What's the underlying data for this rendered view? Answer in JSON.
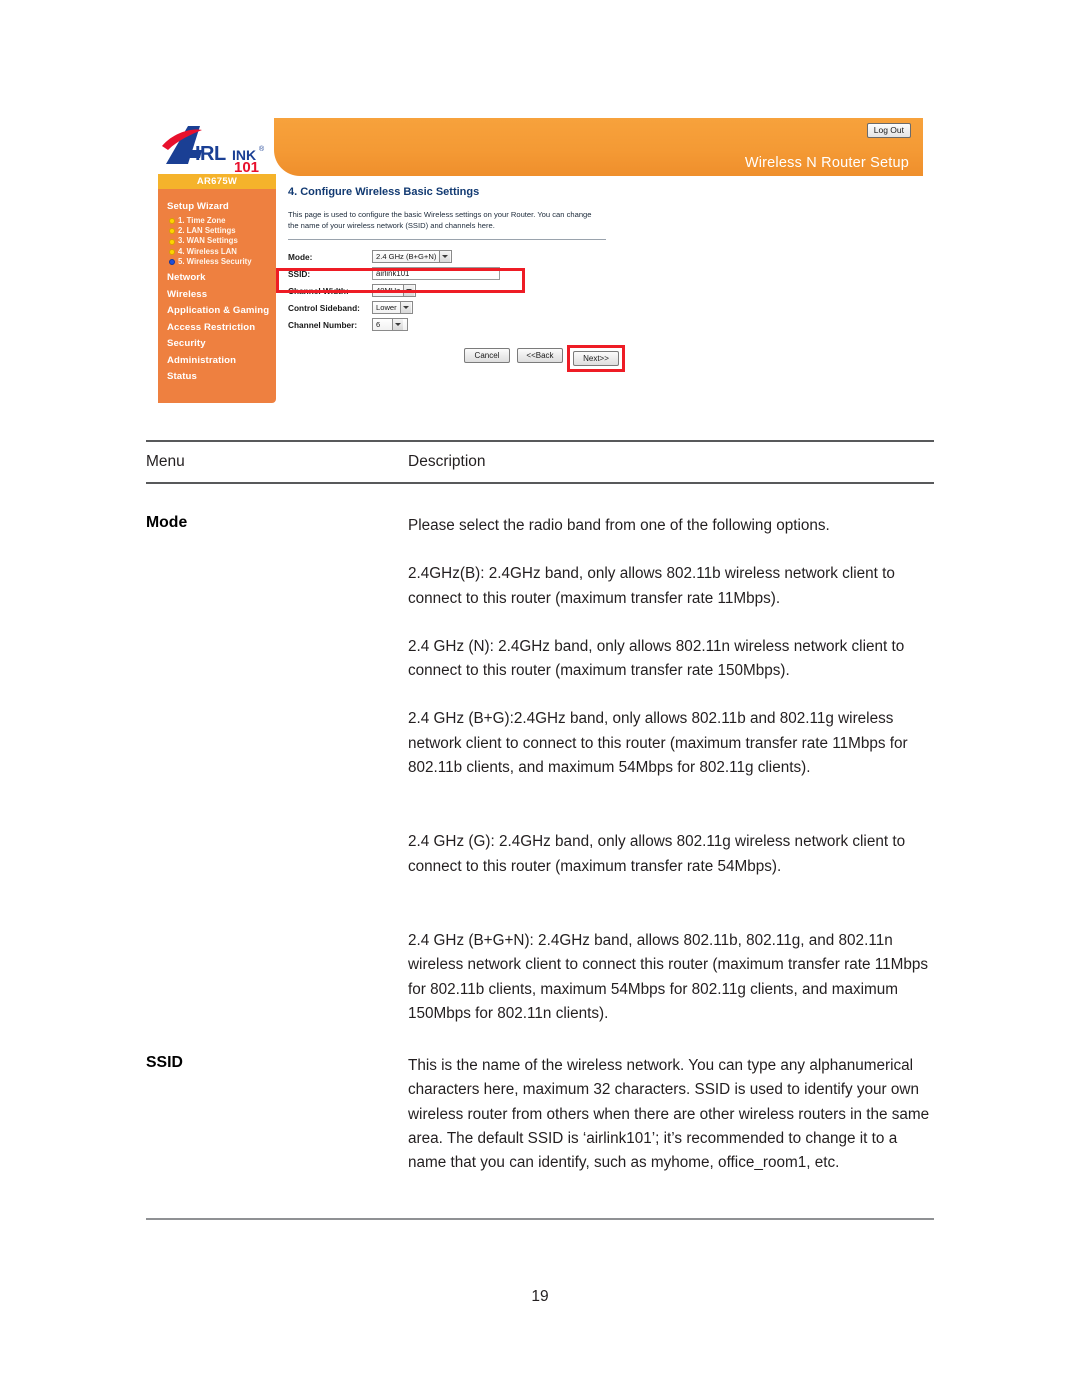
{
  "router_ui": {
    "brand": {
      "name_a": "A",
      "name_rest": "IRLINK",
      "registered": "®",
      "suffix": "101"
    },
    "model": "AR675W",
    "header_title": "Wireless N Router Setup",
    "logout_label": "Log Out",
    "sidebar": {
      "setup_wizard_label": "Setup Wizard",
      "steps": [
        {
          "label": "1. Time Zone",
          "state": "done"
        },
        {
          "label": "2. LAN Settings",
          "state": "done"
        },
        {
          "label": "3. WAN Settings",
          "state": "done"
        },
        {
          "label": "4. Wireless LAN",
          "state": "done"
        },
        {
          "label": "5. Wireless Security",
          "state": "current"
        }
      ],
      "items": [
        {
          "label": "Network"
        },
        {
          "label": "Wireless"
        },
        {
          "label": "Application & Gaming"
        },
        {
          "label": "Access Restriction"
        },
        {
          "label": "Security"
        },
        {
          "label": "Administration"
        },
        {
          "label": "Status"
        }
      ]
    },
    "content": {
      "title": "4.  Configure Wireless Basic Settings",
      "description": "This page is used to configure the basic Wireless settings on your Router. You can change the name of your wireless network (SSID) and channels here.",
      "fields": {
        "mode": {
          "label": "Mode:",
          "value": "2.4 GHz (B+G+N)"
        },
        "ssid": {
          "label": "SSID:",
          "value": "airlink101"
        },
        "channel_width": {
          "label": "Channel Width:",
          "value": "40MHz"
        },
        "control_sideband": {
          "label": "Control Sideband:",
          "value": "Lower"
        },
        "channel_number": {
          "label": "Channel Number:",
          "value": "6"
        }
      },
      "buttons": {
        "cancel": "Cancel",
        "back": "<<Back",
        "next": "Next>>"
      }
    },
    "colors": {
      "header_orange": "#f49a35",
      "sidebar_orange": "#ee8040",
      "model_bar_yellow": "#f5b32b",
      "highlight_red": "#ee1c25",
      "logo_blue": "#1a3f94",
      "logo_red": "#e8112d"
    }
  },
  "document": {
    "table_headers": {
      "menu": "Menu",
      "description": "Description"
    },
    "rows": [
      {
        "menu": "Mode",
        "paragraphs": [
          "Please select the radio band from one of the following options.",
          "2.4GHz(B): 2.4GHz band, only allows 802.11b wireless network client to connect to this router (maximum transfer rate 11Mbps).",
          "2.4 GHz (N): 2.4GHz band, only allows 802.11n wireless network client to connect to this router (maximum transfer rate 150Mbps).",
          "2.4 GHz (B+G):2.4GHz band, only allows 802.11b and 802.11g wireless network client to connect to this router (maximum transfer rate 11Mbps for 802.11b clients, and maximum 54Mbps for 802.11g clients).",
          "2.4 GHz (G): 2.4GHz band, only allows 802.11g wireless network client to connect to this router (maximum transfer rate 54Mbps).",
          "2.4 GHz (B+G+N): 2.4GHz band, allows 802.11b, 802.11g, and 802.11n wireless network client to connect this router (maximum transfer rate 11Mbps for 802.11b clients, maximum 54Mbps for 802.11g clients, and maximum 150Mbps for 802.11n clients)."
        ]
      },
      {
        "menu": "SSID",
        "paragraphs": [
          "This is the name of the wireless network. You can type any alphanumerical characters here, maximum 32 characters. SSID is used to identify your own wireless router from others when there are other wireless routers in the same area. The default SSID is ‘airlink101’; it’s recommended to change it to a name that you can identify, such as myhome, office_room1, etc."
        ]
      }
    ],
    "page_number": "19"
  }
}
